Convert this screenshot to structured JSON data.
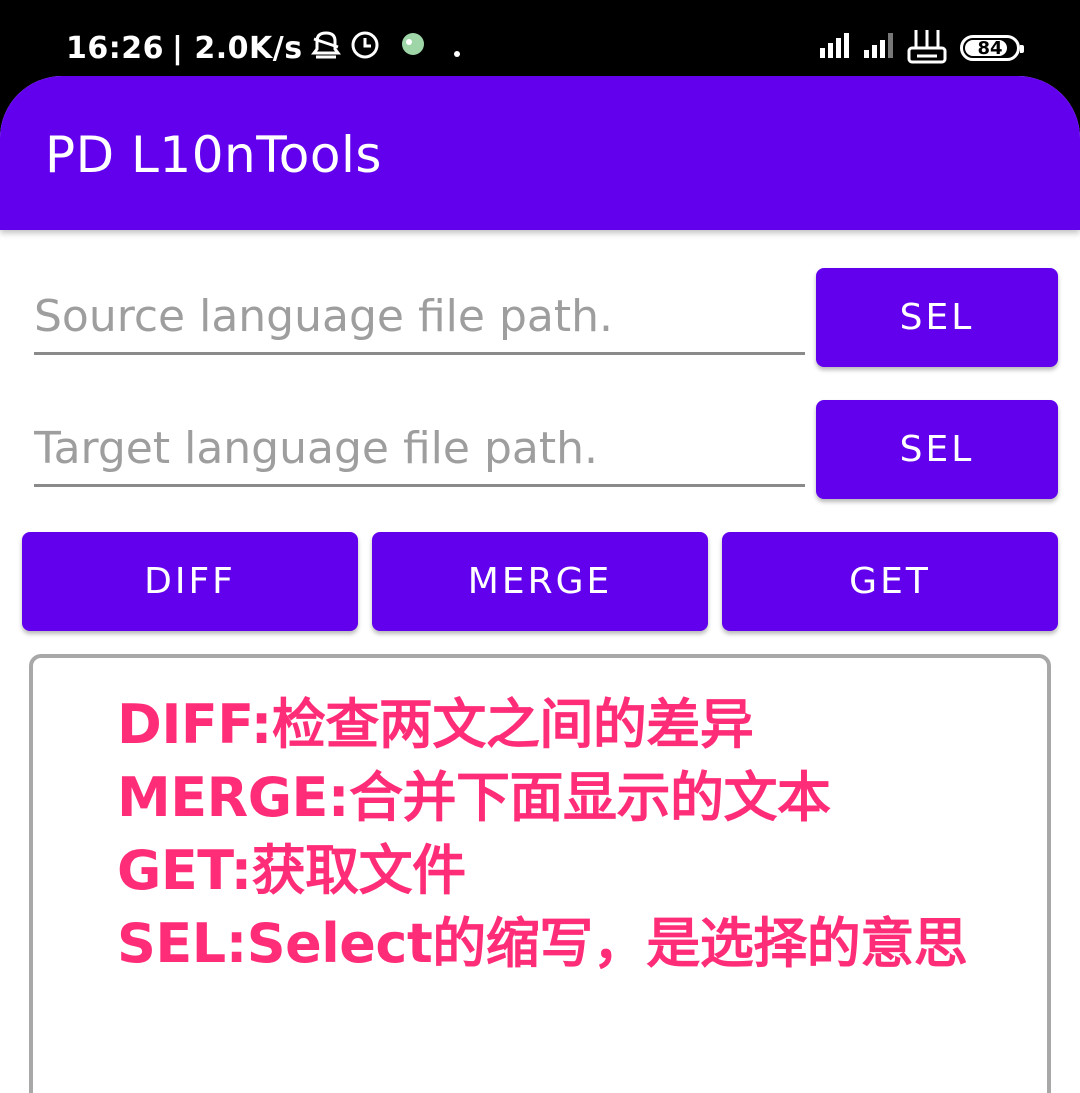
{
  "status_bar": {
    "time": "16:26",
    "network_speed": "| 2.0K/s",
    "battery_level": "84",
    "battery_fraction": 0.84,
    "icons_left": [
      "notification-bell-icon",
      "alarm-clock-icon",
      "app-notification-icon",
      "dot-icon"
    ],
    "icons_right": [
      "signal-strength-icon",
      "signal-strength-2-icon",
      "wifi-hotspot-icon",
      "battery-icon"
    ]
  },
  "app_bar": {
    "title": "PD L10nTools",
    "color": "#6200ee"
  },
  "form": {
    "source_path": {
      "value": "",
      "placeholder": "Source language file path."
    },
    "target_path": {
      "value": "",
      "placeholder": "Target language file path."
    },
    "sel_source_label": "SEL",
    "sel_target_label": "SEL"
  },
  "actions": {
    "diff_label": "DIFF",
    "merge_label": "MERGE",
    "get_label": "GET"
  },
  "output": {
    "lines": [
      "DIFF:检查两文之间的差异",
      "MERGE:合并下面显示的文本",
      "GET:获取文件",
      "SEL:Select的缩写，是选择的意思"
    ],
    "text_color": "#ff2d78"
  }
}
